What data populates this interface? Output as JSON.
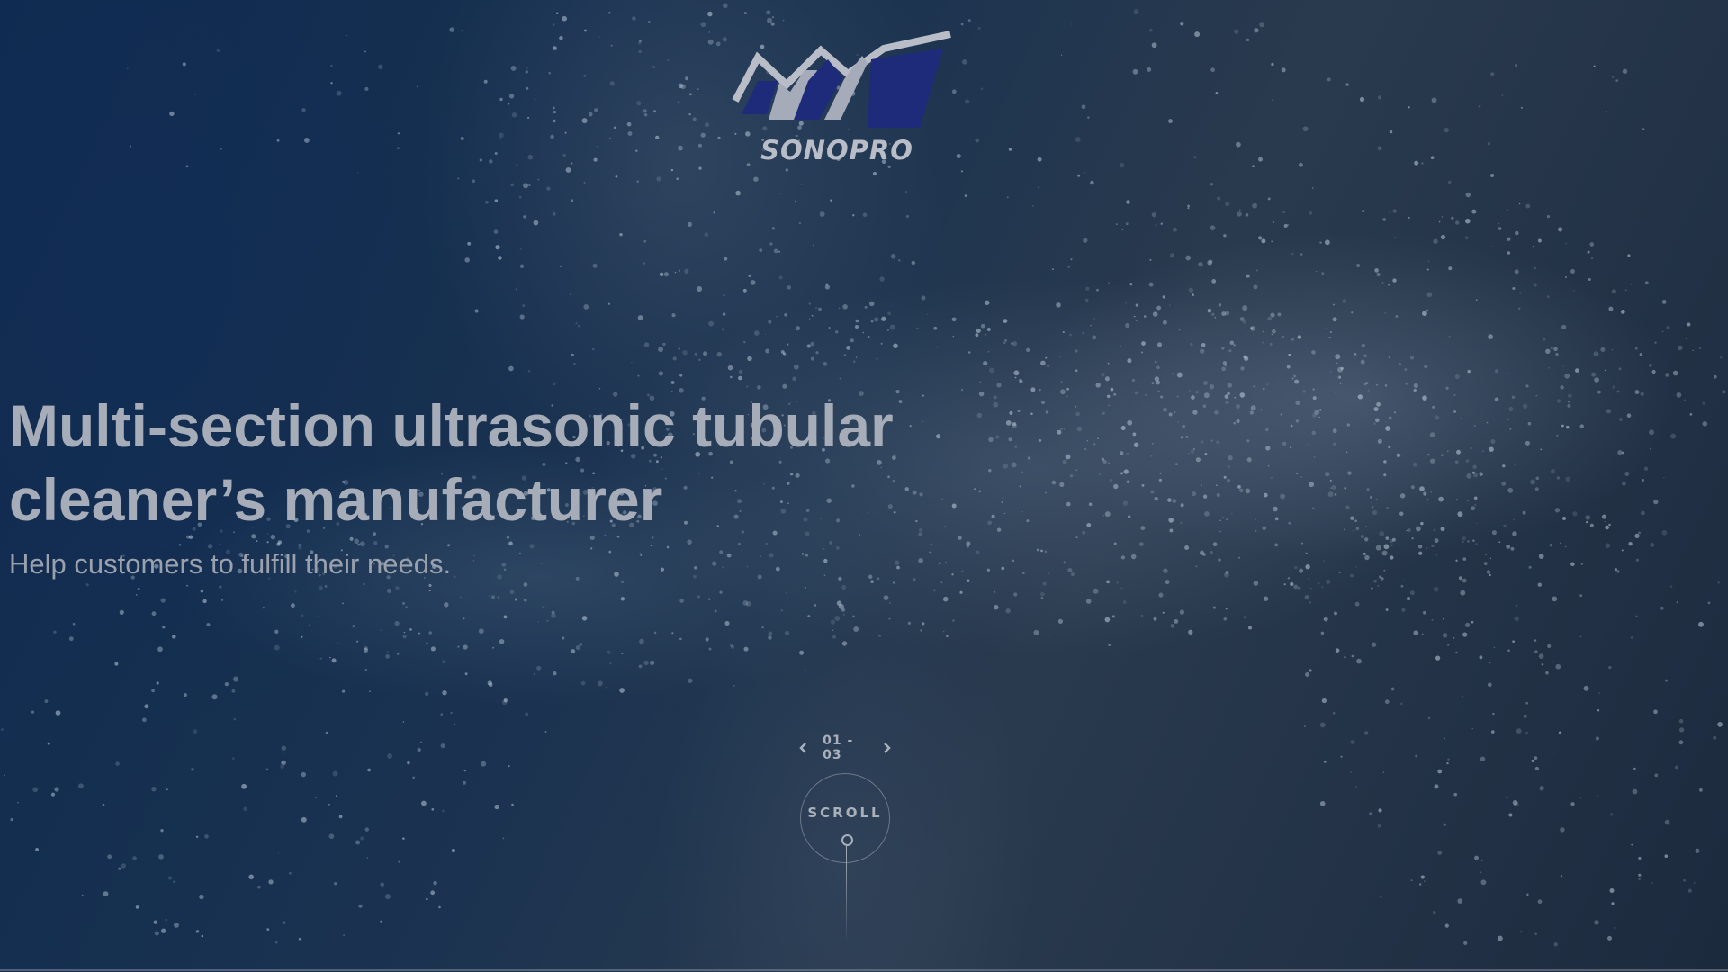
{
  "brand": {
    "name": "SONOPRO",
    "logo_icon": "sonopro-wave-logo-icon",
    "colors": {
      "logo_blue": "#1e2a7a",
      "logo_grey": "#b8bdc8"
    }
  },
  "hero": {
    "headline": "Multi-section ultrasonic tubular cleaner’s manufacturer",
    "subheadline": "Help customers to fulfill their needs."
  },
  "slider": {
    "prev_icon": "chevron-left-icon",
    "next_icon": "chevron-right-icon",
    "counter": "01 - 03",
    "current": 1,
    "total": 3
  },
  "scroll_indicator": {
    "label": "SCROLL",
    "icon": "scroll-down-icon"
  },
  "theme": {
    "background": "#0f2038",
    "text": "#a7adb8"
  }
}
